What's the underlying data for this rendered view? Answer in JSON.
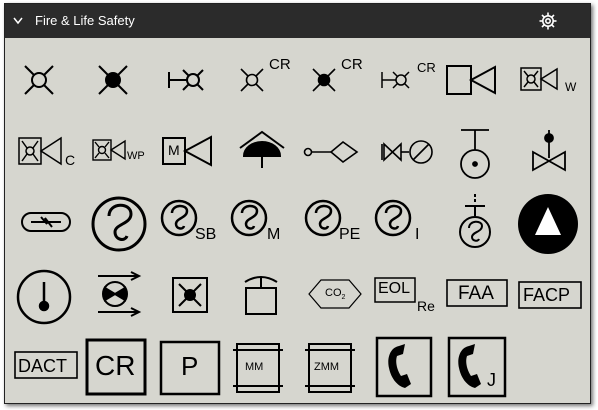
{
  "panel": {
    "title": "Fire & Life Safety",
    "collapse_icon": "chevron-down-icon",
    "settings_icon": "gear-icon"
  },
  "symbols": {
    "cr_1": "CR",
    "cr_2": "CR",
    "cr_3": "CR",
    "valve_w": "W",
    "valve_c": "C",
    "valve_wp": "WP",
    "valve_m": "M",
    "smoke_sb": "SB",
    "smoke_m": "M",
    "smoke_pe": "PE",
    "smoke_i": "I",
    "co2": "CO",
    "co2_sub": "2",
    "eol": "EOL",
    "eol_sub": "Re",
    "faa": "FAA",
    "facp": "FACP",
    "dact": "DACT",
    "cr_box": "CR",
    "p_box": "P",
    "mm": "MM",
    "zmm": "ZMM",
    "phone_j": "J"
  }
}
